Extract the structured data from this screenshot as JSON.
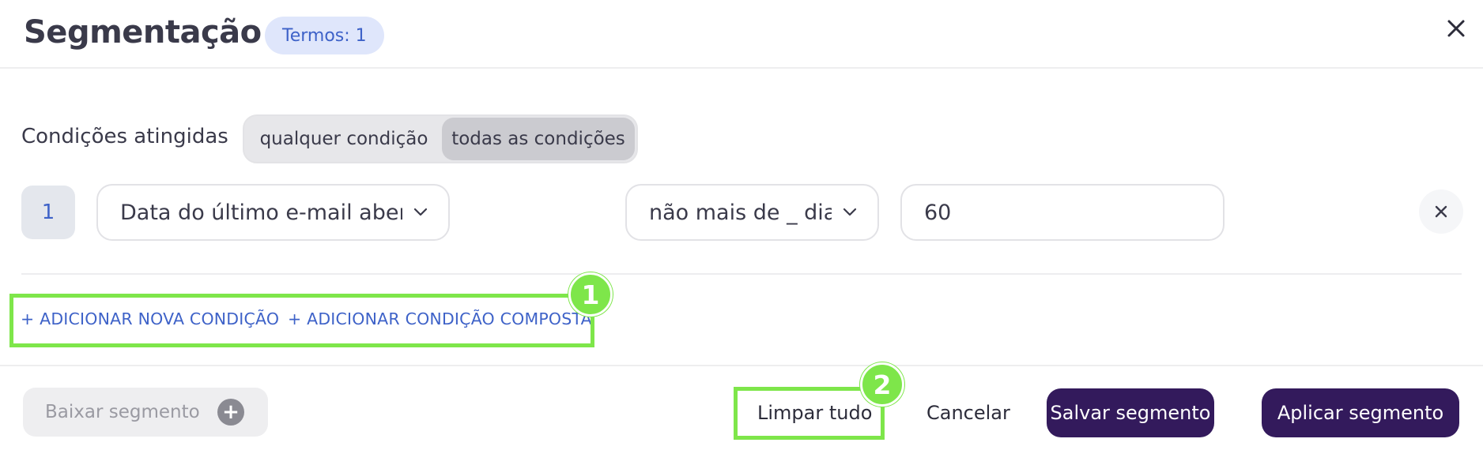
{
  "header": {
    "title": "Segmentação",
    "terms_badge": "Termos: 1",
    "close_icon": "close-icon"
  },
  "conditions": {
    "label": "Condições atingidas",
    "toggle_options": [
      "qualquer condição",
      "todas as condições"
    ],
    "selected_option": "todas as condições"
  },
  "rule": {
    "index": "1",
    "field": "Data do último e-mail aberto",
    "operator": "não mais de _ dias",
    "value": "60"
  },
  "actions": {
    "add_condition": "+ ADICIONAR NOVA CONDIÇÃO",
    "add_compound": "+ ADICIONAR CONDIÇÃO COMPOSTA"
  },
  "annotations": {
    "marker_1": "1",
    "marker_2": "2",
    "highlight_color": "#7ee64a"
  },
  "footer": {
    "download_label": "Baixar segmento",
    "clear_label": "Limpar tudo",
    "cancel_label": "Cancelar",
    "save_label": "Salvar segmento",
    "apply_label": "Aplicar segmento"
  },
  "colors": {
    "accent": "#3e62c8",
    "primary_button": "#331a5c",
    "badge_bg": "#dfe6fb"
  }
}
